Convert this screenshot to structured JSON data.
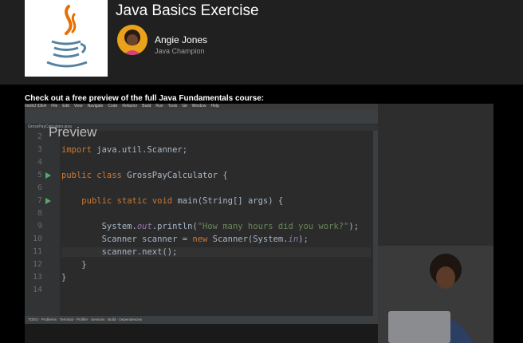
{
  "course": {
    "title": "Java Basics Exercise",
    "author_name": "Angie Jones",
    "author_role": "Java Champion"
  },
  "preview_caption": "Check out a free preview of the full Java Fundamentals course:",
  "video": {
    "watermark": "Preview",
    "ide_menu": [
      "IntelliJ IDEA",
      "File",
      "Edit",
      "View",
      "Navigate",
      "Code",
      "Refactor",
      "Build",
      "Run",
      "Tools",
      "Git",
      "Window",
      "Help"
    ],
    "ide_tab": "GrossPayCalculator.java",
    "code_lines": [
      {
        "n": "2",
        "text": ""
      },
      {
        "n": "3",
        "text": "import java.util.Scanner;"
      },
      {
        "n": "4",
        "text": ""
      },
      {
        "n": "5",
        "text": "public class GrossPayCalculator {"
      },
      {
        "n": "6",
        "text": ""
      },
      {
        "n": "7",
        "text": "    public static void main(String[] args) {"
      },
      {
        "n": "8",
        "text": ""
      },
      {
        "n": "9",
        "text": "        System.out.println(\"How many hours did you work?\");"
      },
      {
        "n": "10",
        "text": "        Scanner scanner = new Scanner(System.in);"
      },
      {
        "n": "11",
        "text": "        scanner.next();"
      },
      {
        "n": "12",
        "text": "    }"
      },
      {
        "n": "13",
        "text": "}"
      },
      {
        "n": "14",
        "text": ""
      }
    ]
  },
  "colors": {
    "header_bg": "#202020",
    "java_orange": "#e76f00",
    "java_blue": "#5382a1",
    "keyword": "#cc7832",
    "string": "#6a8759"
  }
}
